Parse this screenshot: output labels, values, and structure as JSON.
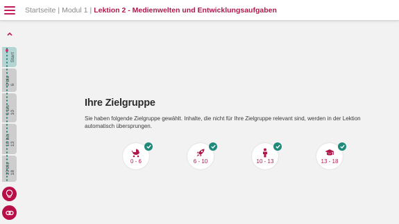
{
  "header": {
    "breadcrumbs": [
      "Startseite",
      "Modul 1",
      "Lektion 2 - Medienwelten und Entwicklungsaufgaben"
    ],
    "accent": "#b0174a"
  },
  "progress": {
    "sections": [
      "Start",
      "0 bis 6",
      "6 bis 10",
      "10 bis 13",
      "13 bis 18"
    ],
    "dot_color": "#1f7f74"
  },
  "main": {
    "title": "Ihre Zielgruppe",
    "description": "Sie haben folgende Zielgruppe gewählt. Inhalte, die nicht für Ihre Zielgruppe relevant sind, werden in der Lektion automatisch übersprungen."
  },
  "groups": [
    {
      "label": "0 - 6",
      "icon": "stroller-icon",
      "selected": true
    },
    {
      "label": "6 - 10",
      "icon": "rocket-icon",
      "selected": true
    },
    {
      "label": "10 - 13",
      "icon": "child-icon",
      "selected": true
    },
    {
      "label": "13 - 18",
      "icon": "graduation-cap-icon",
      "selected": true
    }
  ],
  "colors": {
    "check": "#1f8a7a",
    "button": "#b80f47",
    "background": "#f2f2f2"
  }
}
